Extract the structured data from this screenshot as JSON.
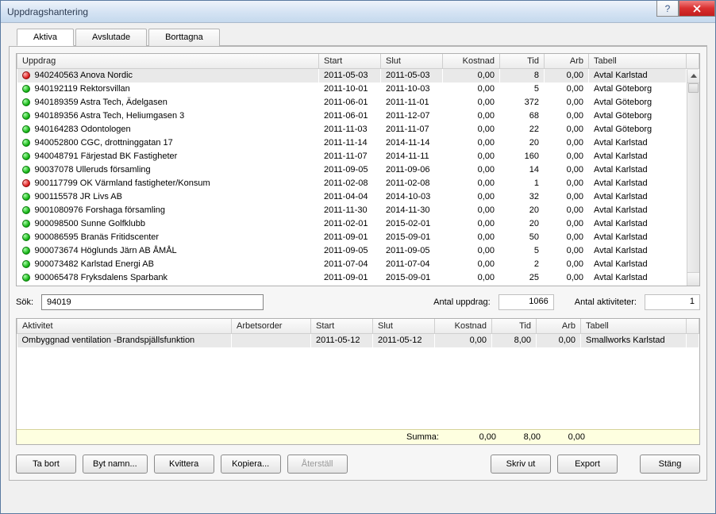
{
  "window": {
    "title": "Uppdragshantering"
  },
  "tabs": {
    "active": "Aktiva",
    "inactive1": "Avslutade",
    "inactive2": "Borttagna"
  },
  "grid1": {
    "headers": {
      "uppdrag": "Uppdrag",
      "start": "Start",
      "slut": "Slut",
      "kostnad": "Kostnad",
      "tid": "Tid",
      "arb": "Arb",
      "tabell": "Tabell"
    },
    "rows": [
      {
        "status": "red",
        "uppdrag": "940240563 Anova Nordic",
        "start": "2011-05-03",
        "slut": "2011-05-03",
        "kostnad": "0,00",
        "tid": "8",
        "arb": "0,00",
        "tabell": "Avtal Karlstad",
        "sel": true
      },
      {
        "status": "green",
        "uppdrag": "940192119 Rektorsvillan",
        "start": "2011-10-01",
        "slut": "2011-10-03",
        "kostnad": "0,00",
        "tid": "5",
        "arb": "0,00",
        "tabell": "Avtal Göteborg"
      },
      {
        "status": "green",
        "uppdrag": "940189359 Astra Tech, Ädelgasen",
        "start": "2011-06-01",
        "slut": "2011-11-01",
        "kostnad": "0,00",
        "tid": "372",
        "arb": "0,00",
        "tabell": "Avtal Göteborg"
      },
      {
        "status": "green",
        "uppdrag": "940189356 Astra Tech, Heliumgasen 3",
        "start": "2011-06-01",
        "slut": "2011-12-07",
        "kostnad": "0,00",
        "tid": "68",
        "arb": "0,00",
        "tabell": "Avtal Göteborg"
      },
      {
        "status": "green",
        "uppdrag": "940164283 Odontologen",
        "start": "2011-11-03",
        "slut": "2011-11-07",
        "kostnad": "0,00",
        "tid": "22",
        "arb": "0,00",
        "tabell": "Avtal Göteborg"
      },
      {
        "status": "green",
        "uppdrag": "940052800 CGC, drottninggatan 17",
        "start": "2011-11-14",
        "slut": "2014-11-14",
        "kostnad": "0,00",
        "tid": "20",
        "arb": "0,00",
        "tabell": "Avtal Karlstad"
      },
      {
        "status": "green",
        "uppdrag": "940048791 Färjestad BK Fastigheter",
        "start": "2011-11-07",
        "slut": "2014-11-11",
        "kostnad": "0,00",
        "tid": "160",
        "arb": "0,00",
        "tabell": "Avtal Karlstad"
      },
      {
        "status": "green",
        "uppdrag": "90037078 Ulleruds församling",
        "start": "2011-09-05",
        "slut": "2011-09-06",
        "kostnad": "0,00",
        "tid": "14",
        "arb": "0,00",
        "tabell": "Avtal Karlstad"
      },
      {
        "status": "red",
        "uppdrag": "900117799 OK Värmland fastigheter/Konsum",
        "start": "2011-02-08",
        "slut": "2011-02-08",
        "kostnad": "0,00",
        "tid": "1",
        "arb": "0,00",
        "tabell": "Avtal Karlstad"
      },
      {
        "status": "green",
        "uppdrag": "900115578 JR Livs AB",
        "start": "2011-04-04",
        "slut": "2014-10-03",
        "kostnad": "0,00",
        "tid": "32",
        "arb": "0,00",
        "tabell": "Avtal Karlstad"
      },
      {
        "status": "green",
        "uppdrag": "9001080976 Forshaga församling",
        "start": "2011-11-30",
        "slut": "2014-11-30",
        "kostnad": "0,00",
        "tid": "20",
        "arb": "0,00",
        "tabell": "Avtal Karlstad"
      },
      {
        "status": "green",
        "uppdrag": "900098500 Sunne Golfklubb",
        "start": "2011-02-01",
        "slut": "2015-02-01",
        "kostnad": "0,00",
        "tid": "20",
        "arb": "0,00",
        "tabell": "Avtal Karlstad"
      },
      {
        "status": "green",
        "uppdrag": "900086595 Branäs Fritidscenter",
        "start": "2011-09-01",
        "slut": "2015-09-01",
        "kostnad": "0,00",
        "tid": "50",
        "arb": "0,00",
        "tabell": "Avtal Karlstad"
      },
      {
        "status": "green",
        "uppdrag": "900073674 Höglunds Järn AB ÅMÅL",
        "start": "2011-09-05",
        "slut": "2011-09-05",
        "kostnad": "0,00",
        "tid": "5",
        "arb": "0,00",
        "tabell": "Avtal Karlstad"
      },
      {
        "status": "green",
        "uppdrag": "900073482 Karlstad Energi AB",
        "start": "2011-07-04",
        "slut": "2011-07-04",
        "kostnad": "0,00",
        "tid": "2",
        "arb": "0,00",
        "tabell": "Avtal Karlstad"
      },
      {
        "status": "green",
        "uppdrag": "900065478 Fryksdalens Sparbank",
        "start": "2011-09-01",
        "slut": "2015-09-01",
        "kostnad": "0,00",
        "tid": "25",
        "arb": "0,00",
        "tabell": "Avtal Karlstad"
      }
    ]
  },
  "search": {
    "label": "Sök:",
    "value": "94019"
  },
  "counts": {
    "uppdrag_label": "Antal uppdrag:",
    "uppdrag_value": "1066",
    "akt_label": "Antal aktiviteter:",
    "akt_value": "1"
  },
  "grid2": {
    "headers": {
      "aktivitet": "Aktivitet",
      "arbetsorder": "Arbetsorder",
      "start": "Start",
      "slut": "Slut",
      "kostnad": "Kostnad",
      "tid": "Tid",
      "arb": "Arb",
      "tabell": "Tabell"
    },
    "rows": [
      {
        "aktivitet": "Ombyggnad ventilation -Brandspjällsfunktion",
        "arbetsorder": "",
        "start": "2011-05-12",
        "slut": "2011-05-12",
        "kostnad": "0,00",
        "tid": "8,00",
        "arb": "0,00",
        "tabell": "Smallworks Karlstad",
        "sel": true
      }
    ],
    "sum": {
      "label": "Summa:",
      "kostnad": "0,00",
      "tid": "8,00",
      "arb": "0,00"
    }
  },
  "buttons": {
    "ta_bort": "Ta bort",
    "byt_namn": "Byt namn...",
    "kvittera": "Kvittera",
    "kopiera": "Kopiera...",
    "aterstall": "Återställ",
    "skriv_ut": "Skriv ut",
    "export": "Export",
    "stang": "Stäng"
  }
}
